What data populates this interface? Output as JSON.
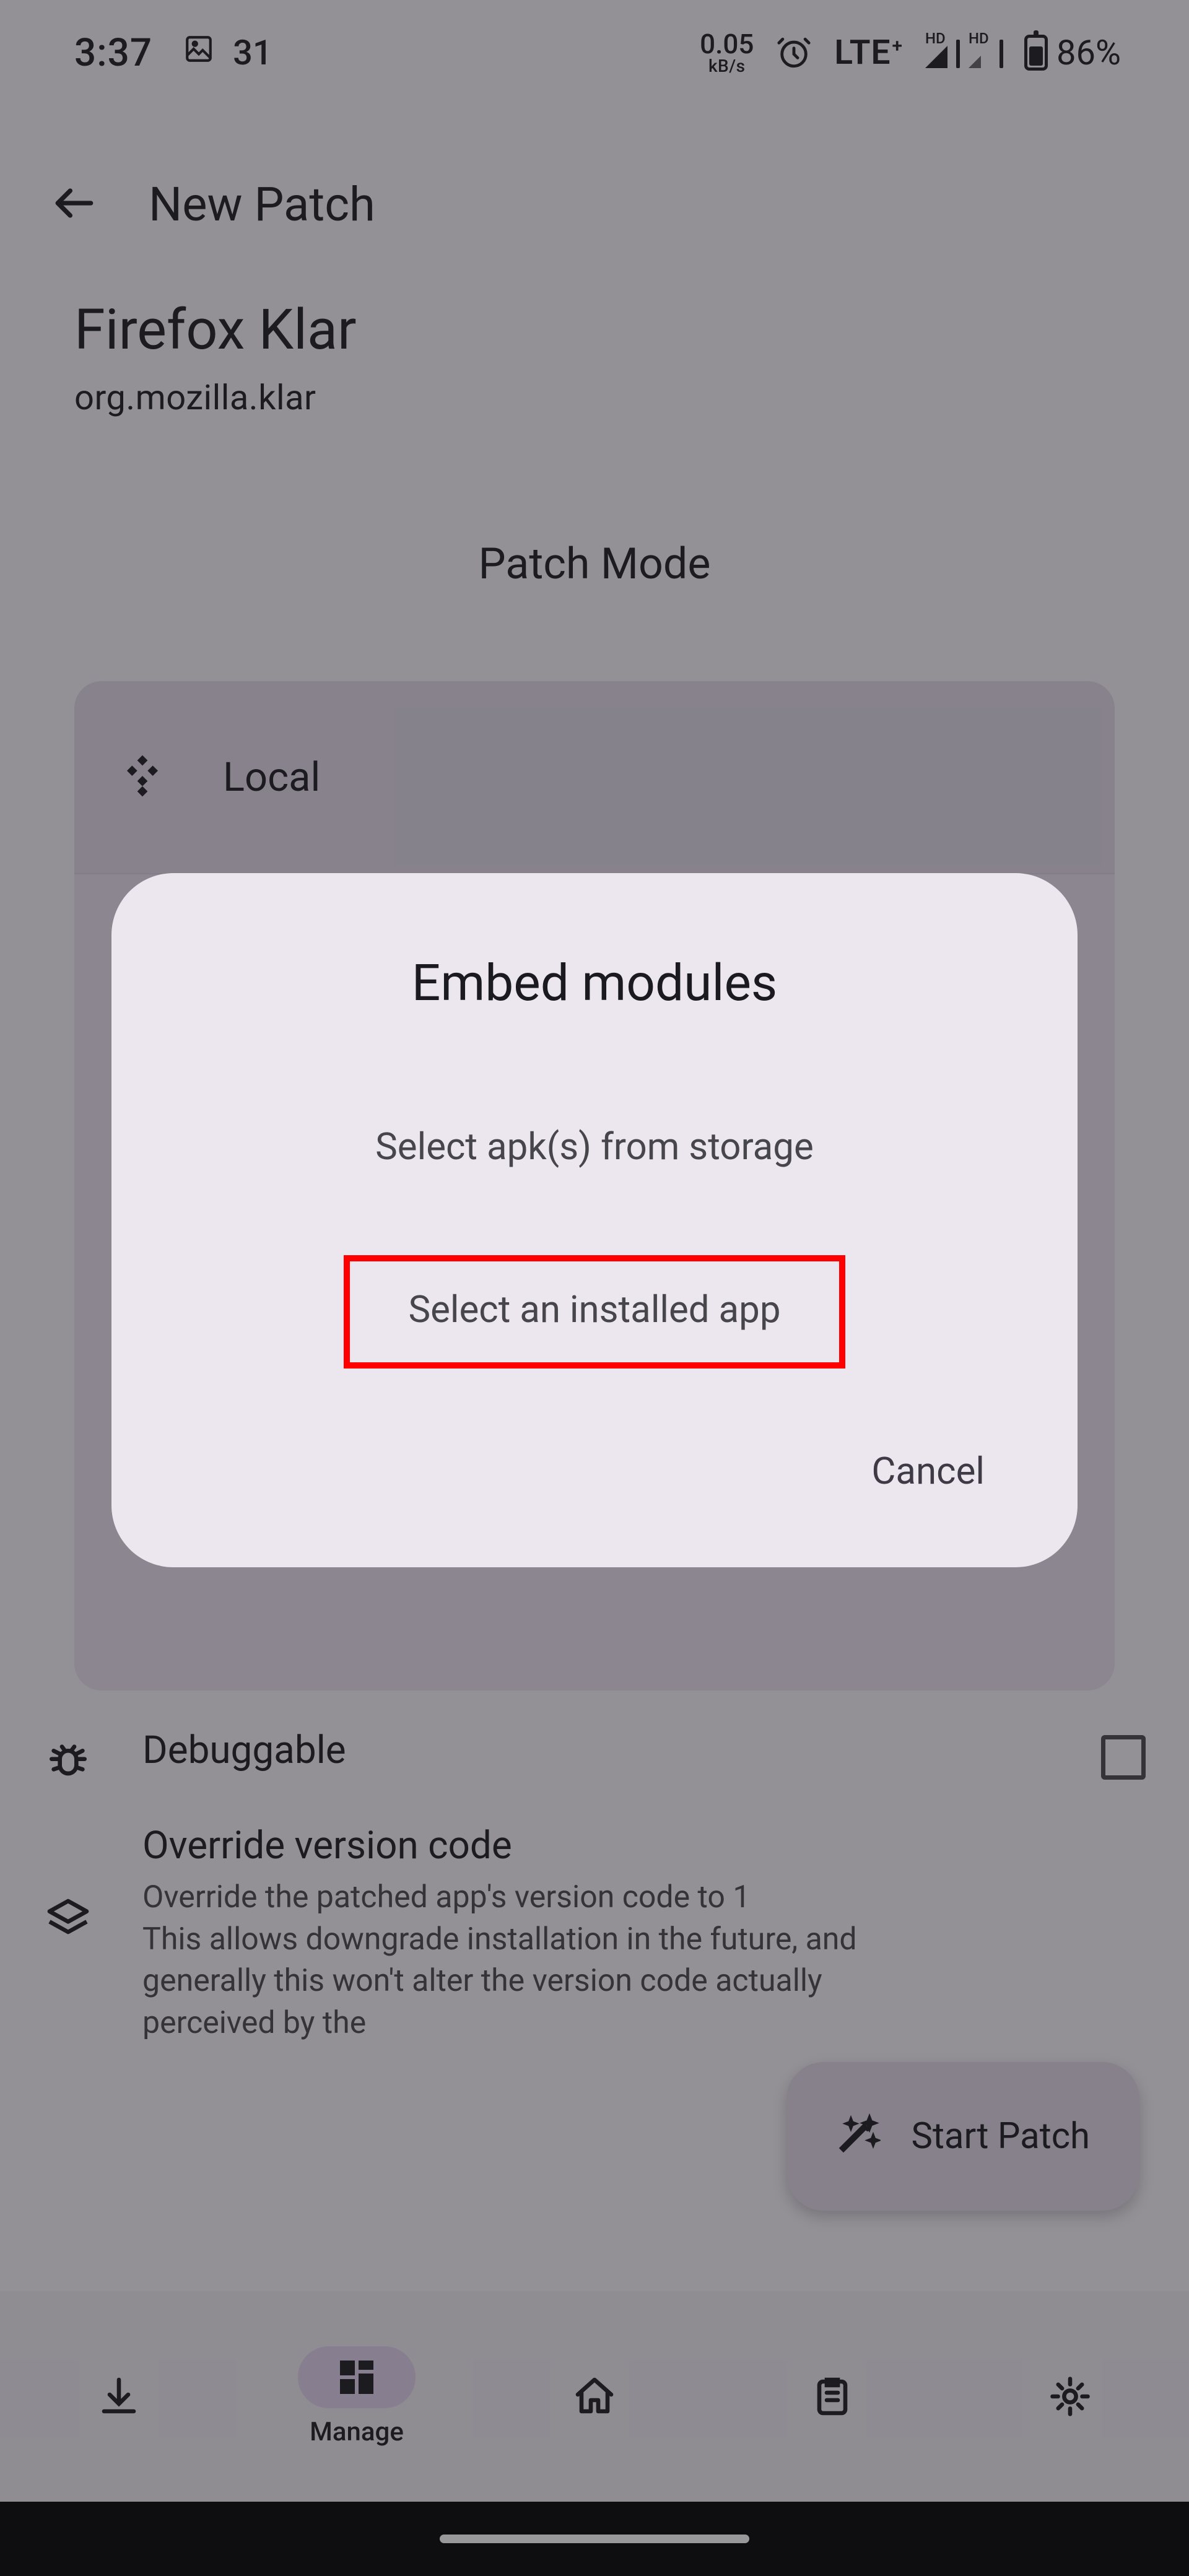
{
  "status": {
    "time": "3:37",
    "temp": "31",
    "rate": "0.05",
    "rate_unit": "kB/s",
    "network": "LTE",
    "network_plus": "+",
    "hd": "HD",
    "battery_pct": "86%"
  },
  "appbar": {
    "title": "New Patch"
  },
  "app": {
    "name": "Firefox Klar",
    "package": "org.mozilla.klar"
  },
  "section": {
    "patch_mode_title": "Patch Mode"
  },
  "modes": {
    "local_label": "Local"
  },
  "options": {
    "debuggable_title": "Debuggable",
    "override_title": "Override version code",
    "override_desc": "Override the patched app's version code to 1\nThis allows downgrade installation in the future, and generally this won't alter the version code actually perceived by the"
  },
  "fab": {
    "start_patch": "Start Patch"
  },
  "nav": {
    "manage": "Manage"
  },
  "dialog": {
    "title": "Embed modules",
    "opt_storage": "Select apk(s) from storage",
    "opt_installed": "Select an installed app",
    "cancel": "Cancel"
  }
}
